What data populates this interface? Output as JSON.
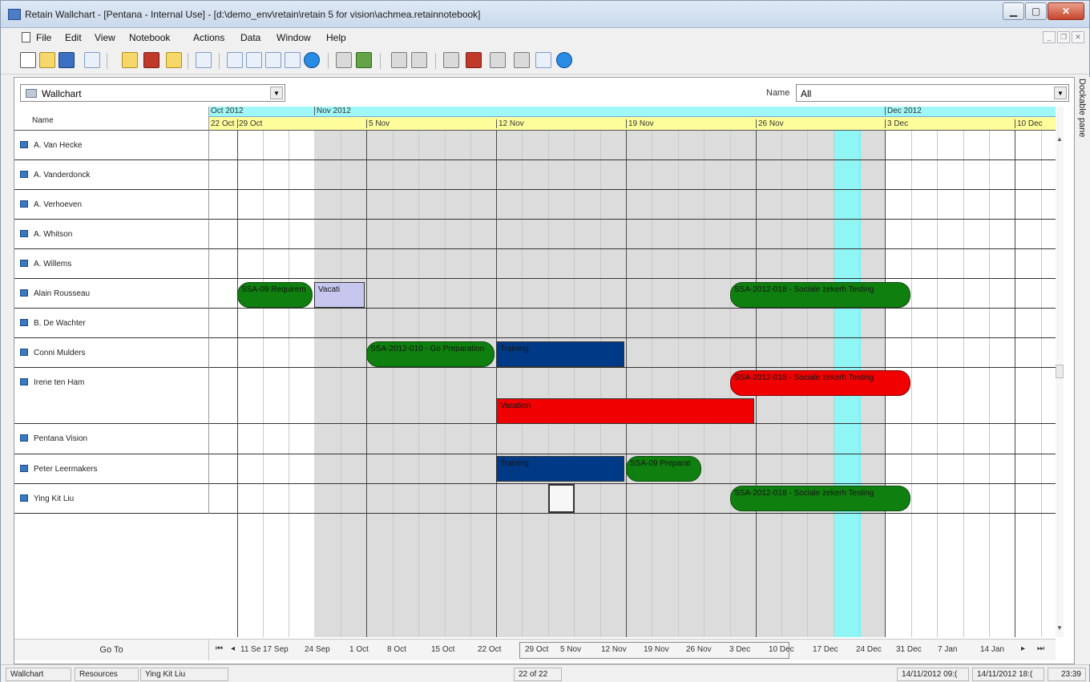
{
  "window": {
    "title": "Retain Wallchart - [Pentana - Internal Use] - [d:\\demo_env\\retain\\retain 5 for vision\\achmea.retainnotebook]"
  },
  "menu": [
    "File",
    "Edit",
    "View",
    "Notebook",
    "Actions",
    "Data",
    "Window",
    "Help"
  ],
  "view_select": {
    "value": "Wallchart"
  },
  "name_filter": {
    "label": "Name",
    "value": "All"
  },
  "dockable_pane": "Dockable pane",
  "header": {
    "name_col": "Name",
    "months": [
      "Oct 2012",
      "Nov 2012",
      "Dec 2012"
    ],
    "weeks": [
      "22 Oct",
      "29 Oct",
      "5 Nov",
      "12 Nov",
      "19 Nov",
      "26 Nov",
      "3 Dec",
      "10 Dec"
    ]
  },
  "resources": [
    "A. Van Hecke",
    "A. Vanderdonck",
    "A. Verhoeven",
    "A. Whitson",
    "A. Willems",
    "Alain Rousseau",
    "B. De Wachter",
    "Conni Mulders",
    "Irene ten Ham",
    "Pentana Vision",
    "Peter Leermakers",
    "Ying Kit Liu"
  ],
  "bookings": [
    {
      "label": "SSA-09 Requirem",
      "color": "#0f7f0f"
    },
    {
      "label": "Vacati",
      "color": "#c6c6ee"
    },
    {
      "label": "SSA-2012-018 - Sociale zekerh Testing",
      "color": "#0f7f0f"
    },
    {
      "label": "SSA-2012-010 - Go Preparation",
      "color": "#0f7f0f"
    },
    {
      "label": "Training",
      "color": "#003a86"
    },
    {
      "label": "SSA-2012-018 - Sociale zekerh Testing",
      "color": "#f00000"
    },
    {
      "label": "Vacation",
      "color": "#f00000"
    },
    {
      "label": "Training",
      "color": "#003a86"
    },
    {
      "label": "SSA-09 Preparat",
      "color": "#0f7f0f"
    },
    {
      "label": "SSA-2012-018 - Sociale zekerh Testing",
      "color": "#0f7f0f"
    }
  ],
  "goto": {
    "label": "Go To",
    "nav_first": "⏮",
    "nav_prev": "◂",
    "nav_next": "▸",
    "nav_last": "⏭",
    "dates": [
      "11 Se",
      "17 Sep",
      "24 Sep",
      "1 Oct",
      "8 Oct",
      "15 Oct",
      "22 Oct",
      "29 Oct",
      "5 Nov",
      "12 Nov",
      "19 Nov",
      "26 Nov",
      "3 Dec",
      "10 Dec",
      "17 Dec",
      "24 Dec",
      "31 Dec",
      "7 Jan",
      "14 Jan"
    ]
  },
  "status": {
    "tab1": "Wallchart",
    "tab2": "Resources",
    "selected": "Ying Kit Liu",
    "count": "22 of 22",
    "start": "14/11/2012 09:(",
    "end": "14/11/2012 18:(",
    "time": "23:39"
  },
  "colors": {
    "month_band": "#9ff7f7",
    "week_band": "#fdfd9b",
    "weekend": "#dcdcdc",
    "today": "#8ff5f5"
  }
}
